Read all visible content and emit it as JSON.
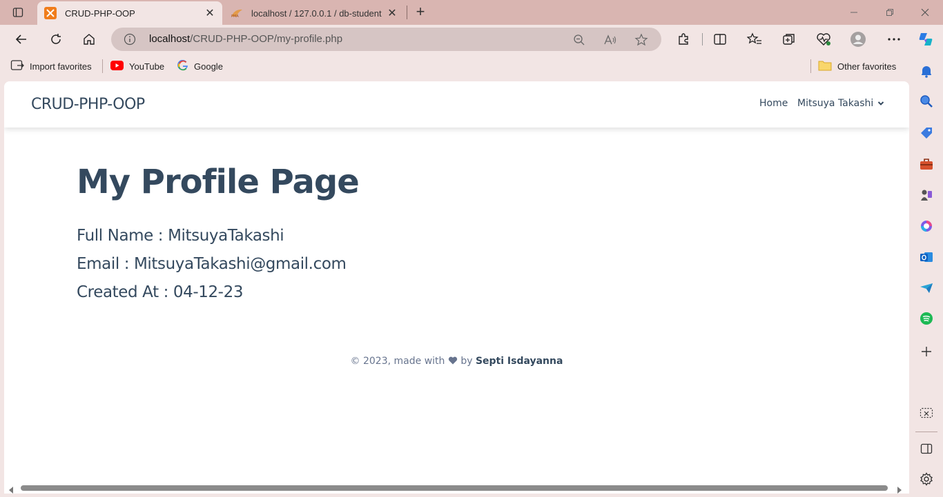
{
  "browser": {
    "tabs": [
      {
        "title": "CRUD-PHP-OOP",
        "active": true
      },
      {
        "title": "localhost / 127.0.0.1 / db-student",
        "active": false
      }
    ],
    "address": {
      "host": "localhost",
      "path": "/CRUD-PHP-OOP/my-profile.php"
    },
    "favorites": [
      {
        "label": "Import favorites",
        "icon": "import-icon"
      },
      {
        "label": "YouTube",
        "icon": "youtube-icon"
      },
      {
        "label": "Google",
        "icon": "google-icon"
      }
    ],
    "other_favorites": "Other favorites"
  },
  "site": {
    "brand": "CRUD-PHP-OOP",
    "nav": {
      "home": "Home",
      "user": "Mitsuya Takashi"
    }
  },
  "profile": {
    "heading": "My Profile Page",
    "full_name": "Full Name : MitsuyaTakashi",
    "email": "Email : MitsuyaTakashi@gmail.com",
    "created_at": "Created At : 04-12-23"
  },
  "footer": {
    "prefix": "© 2023, made with",
    "by": "by",
    "author": "Septi Isdayanna"
  },
  "colors": {
    "accent": "#34495e",
    "tabstrip": "#d9b5b1",
    "chrome": "#f2e5e4"
  }
}
